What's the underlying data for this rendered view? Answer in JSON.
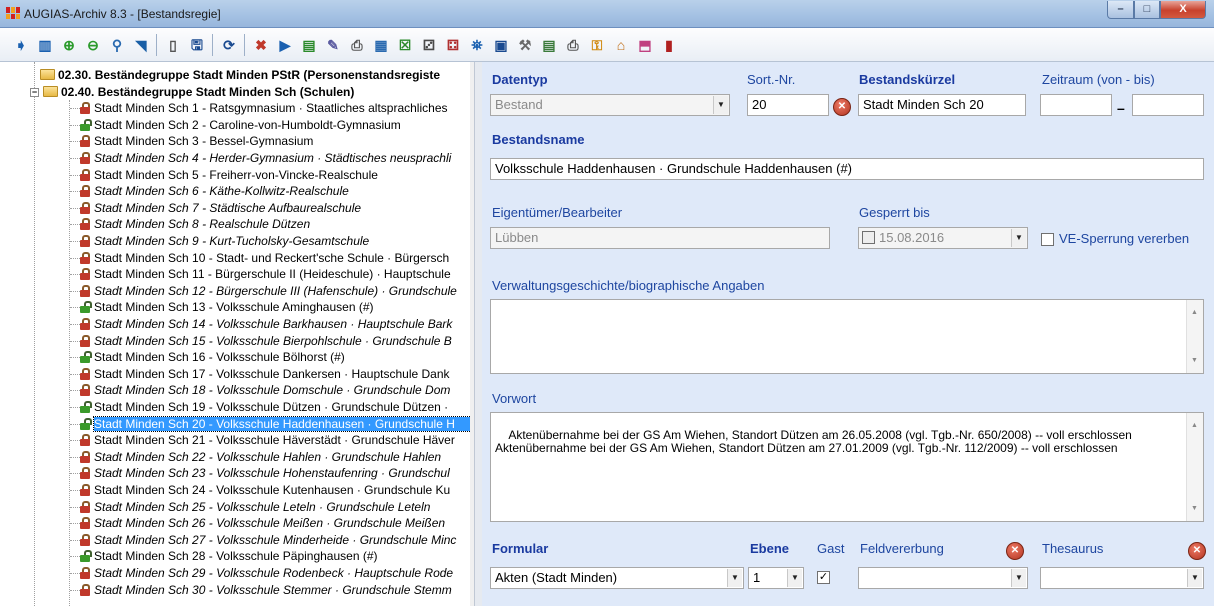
{
  "window": {
    "title": "AUGIAS-Archiv 8.3 - [Bestandsregie]",
    "min": "–",
    "max": "□",
    "close": "X"
  },
  "toolbar": {
    "icons": [
      "arrow-icon",
      "columns-icon",
      "plus-circle-icon",
      "minus-circle-icon",
      "zoom-icon",
      "tag-icon",
      "blank-page-icon",
      "save-icon",
      "refresh-icon",
      "cancel-icon",
      "play-icon",
      "magnify-doc-icon",
      "brush-icon",
      "print-icon",
      "chart-icon",
      "excel-icon",
      "tree-icon",
      "tree2-icon",
      "binoculars-icon",
      "window-icon",
      "tools-icon",
      "list-icon",
      "print2-icon",
      "key-icon",
      "home-icon",
      "cabinet-icon",
      "book-icon"
    ],
    "glyphs": [
      "➧",
      "▥",
      "⊕",
      "⊖",
      "⚲",
      "◥",
      "▯",
      "🖫",
      "⟳",
      "✖",
      "▶",
      "▤",
      "✎",
      "⎙",
      "▦",
      "☒",
      "⚂",
      "⚃",
      "⛯",
      "▣",
      "⚒",
      "▤",
      "⎙",
      "⚿",
      "⌂",
      "⬒",
      "▮"
    ],
    "colors": [
      "#1a60b0",
      "#1a60b0",
      "#2a9a2a",
      "#2a9a2a",
      "#2a6ab0",
      "#1a5fa6",
      "#555555",
      "#1a4a90",
      "#1a4a90",
      "#c0392b",
      "#1a60b0",
      "#2a8a2a",
      "#5a5aa0",
      "#555555",
      "#2a6ab0",
      "#2a8a2a",
      "#4a4a4a",
      "#b03030",
      "#1a60b0",
      "#1a4a90",
      "#6a6a6a",
      "#3a7a3a",
      "#555555",
      "#d08a10",
      "#c06a10",
      "#c04080",
      "#b02020"
    ]
  },
  "tree": {
    "groups": [
      {
        "label": "02.30. Beständegruppe Stadt Minden PStR (Personenstandsregiste",
        "expander": "",
        "expanded": false
      },
      {
        "label": "02.40. Beständegruppe Stadt Minden Sch (Schulen)",
        "expander": "−",
        "expanded": true
      }
    ],
    "items": [
      {
        "label": "Stadt Minden Sch 1 - Ratsgymnasium · Staatliches altsprachliches",
        "italic": false,
        "open": false
      },
      {
        "label": "Stadt Minden Sch 2 - Caroline-von-Humboldt-Gymnasium",
        "italic": false,
        "open": true
      },
      {
        "label": "Stadt Minden Sch 3 - Bessel-Gymnasium",
        "italic": false,
        "open": false
      },
      {
        "label": "Stadt Minden Sch 4 - Herder-Gymnasium · Städtisches neusprachli",
        "italic": true,
        "open": false
      },
      {
        "label": "Stadt Minden Sch 5 - Freiherr-von-Vincke-Realschule",
        "italic": false,
        "open": false
      },
      {
        "label": "Stadt Minden Sch 6 - Käthe-Kollwitz-Realschule",
        "italic": true,
        "open": false
      },
      {
        "label": "Stadt Minden Sch 7 - Städtische Aufbaurealschule",
        "italic": true,
        "open": false
      },
      {
        "label": "Stadt Minden Sch 8 - Realschule Dützen",
        "italic": true,
        "open": false
      },
      {
        "label": "Stadt Minden Sch 9 - Kurt-Tucholsky-Gesamtschule",
        "italic": true,
        "open": false
      },
      {
        "label": "Stadt Minden Sch 10 - Stadt- und Reckert'sche Schule · Bürgersch",
        "italic": false,
        "open": false
      },
      {
        "label": "Stadt Minden Sch 11 - Bürgerschule II (Heideschule) · Hauptschule",
        "italic": false,
        "open": false
      },
      {
        "label": "Stadt Minden Sch 12 - Bürgerschule III (Hafenschule) · Grundschule",
        "italic": true,
        "open": false
      },
      {
        "label": "Stadt Minden Sch 13 - Volksschule Aminghausen (#)",
        "italic": false,
        "open": true
      },
      {
        "label": "Stadt Minden Sch 14 - Volksschule Barkhausen · Hauptschule Bark",
        "italic": true,
        "open": false
      },
      {
        "label": "Stadt Minden Sch 15 - Volksschule Bierpohlschule · Grundschule B",
        "italic": true,
        "open": false
      },
      {
        "label": "Stadt Minden Sch 16 - Volksschule Bölhorst (#)",
        "italic": false,
        "open": true
      },
      {
        "label": "Stadt Minden Sch 17 - Volksschule Dankersen · Hauptschule Dank",
        "italic": false,
        "open": false
      },
      {
        "label": "Stadt Minden Sch 18 - Volksschule Domschule · Grundschule Dom",
        "italic": true,
        "open": false
      },
      {
        "label": "Stadt Minden Sch 19 - Volksschule Dützen · Grundschule Dützen ·",
        "italic": false,
        "open": true
      },
      {
        "label": "Stadt Minden Sch 20 - Volksschule Haddenhausen · Grundschule H",
        "italic": false,
        "open": true,
        "selected": true
      },
      {
        "label": "Stadt Minden Sch 21 - Volksschule Häverstädt · Grundschule Häver",
        "italic": false,
        "open": false
      },
      {
        "label": "Stadt Minden Sch 22 - Volksschule Hahlen · Grundschule Hahlen",
        "italic": true,
        "open": false
      },
      {
        "label": "Stadt Minden Sch 23 - Volksschule Hohenstaufenring · Grundschul",
        "italic": true,
        "open": false
      },
      {
        "label": "Stadt Minden Sch 24 - Volksschule Kutenhausen · Grundschule Ku",
        "italic": false,
        "open": false
      },
      {
        "label": "Stadt Minden Sch 25 - Volksschule Leteln · Grundschule Leteln",
        "italic": true,
        "open": false
      },
      {
        "label": "Stadt Minden Sch 26 - Volksschule Meißen · Grundschule Meißen",
        "italic": true,
        "open": false
      },
      {
        "label": "Stadt Minden Sch 27 - Volksschule Minderheide · Grundschule Minc",
        "italic": true,
        "open": false
      },
      {
        "label": "Stadt Minden Sch 28 - Volksschule Päpinghausen (#)",
        "italic": false,
        "open": true
      },
      {
        "label": "Stadt Minden Sch 29 - Volksschule Rodenbeck · Hauptschule Rode",
        "italic": true,
        "open": false
      },
      {
        "label": "Stadt Minden Sch 30 - Volksschule Stemmer · Grundschule Stemm",
        "italic": true,
        "open": false
      }
    ]
  },
  "form": {
    "datentyp": {
      "label": "Datentyp",
      "value": "Bestand"
    },
    "sortnr": {
      "label": "Sort.-Nr.",
      "value": "20"
    },
    "bestandskuerzel": {
      "label": "Bestandskürzel",
      "value": "Stadt Minden Sch 20"
    },
    "zeitraum": {
      "label": "Zeitraum (von - bis)",
      "from": "",
      "to": "",
      "separator": "–"
    },
    "bestandsname": {
      "label": "Bestandsname",
      "value": "Volksschule Haddenhausen · Grundschule Haddenhausen (#)"
    },
    "eigentuemer": {
      "label": "Eigentümer/Bearbeiter",
      "value": "Lübben"
    },
    "gesperrt": {
      "label": "Gesperrt bis",
      "value": "15.08.2016"
    },
    "ve_sperrung": {
      "label": "VE-Sperrung vererben",
      "checked": false
    },
    "verwaltung": {
      "label": "Verwaltungsgeschichte/biographische Angaben",
      "value": ""
    },
    "vorwort": {
      "label": "Vorwort",
      "value": "Aktenübernahme bei der GS Am Wiehen, Standort Dützen am 26.05.2008 (vgl. Tgb.-Nr. 650/2008) -- voll erschlossen\nAktenübernahme bei der GS Am Wiehen, Standort Dützen am 27.01.2009 (vgl. Tgb.-Nr. 112/2009) -- voll erschlossen"
    },
    "formular": {
      "label": "Formular",
      "value": "Akten (Stadt Minden)"
    },
    "ebene": {
      "label": "Ebene",
      "value": "1"
    },
    "gast": {
      "label": "Gast",
      "checked": true
    },
    "feldvererbung": {
      "label": "Feldvererbung",
      "value": ""
    },
    "thesaurus": {
      "label": "Thesaurus",
      "value": ""
    },
    "clear_glyph": "✕",
    "dropdown_glyph": "▼",
    "check_glyph": "✓",
    "scroll_up": "▲",
    "scroll_down": "▼"
  }
}
